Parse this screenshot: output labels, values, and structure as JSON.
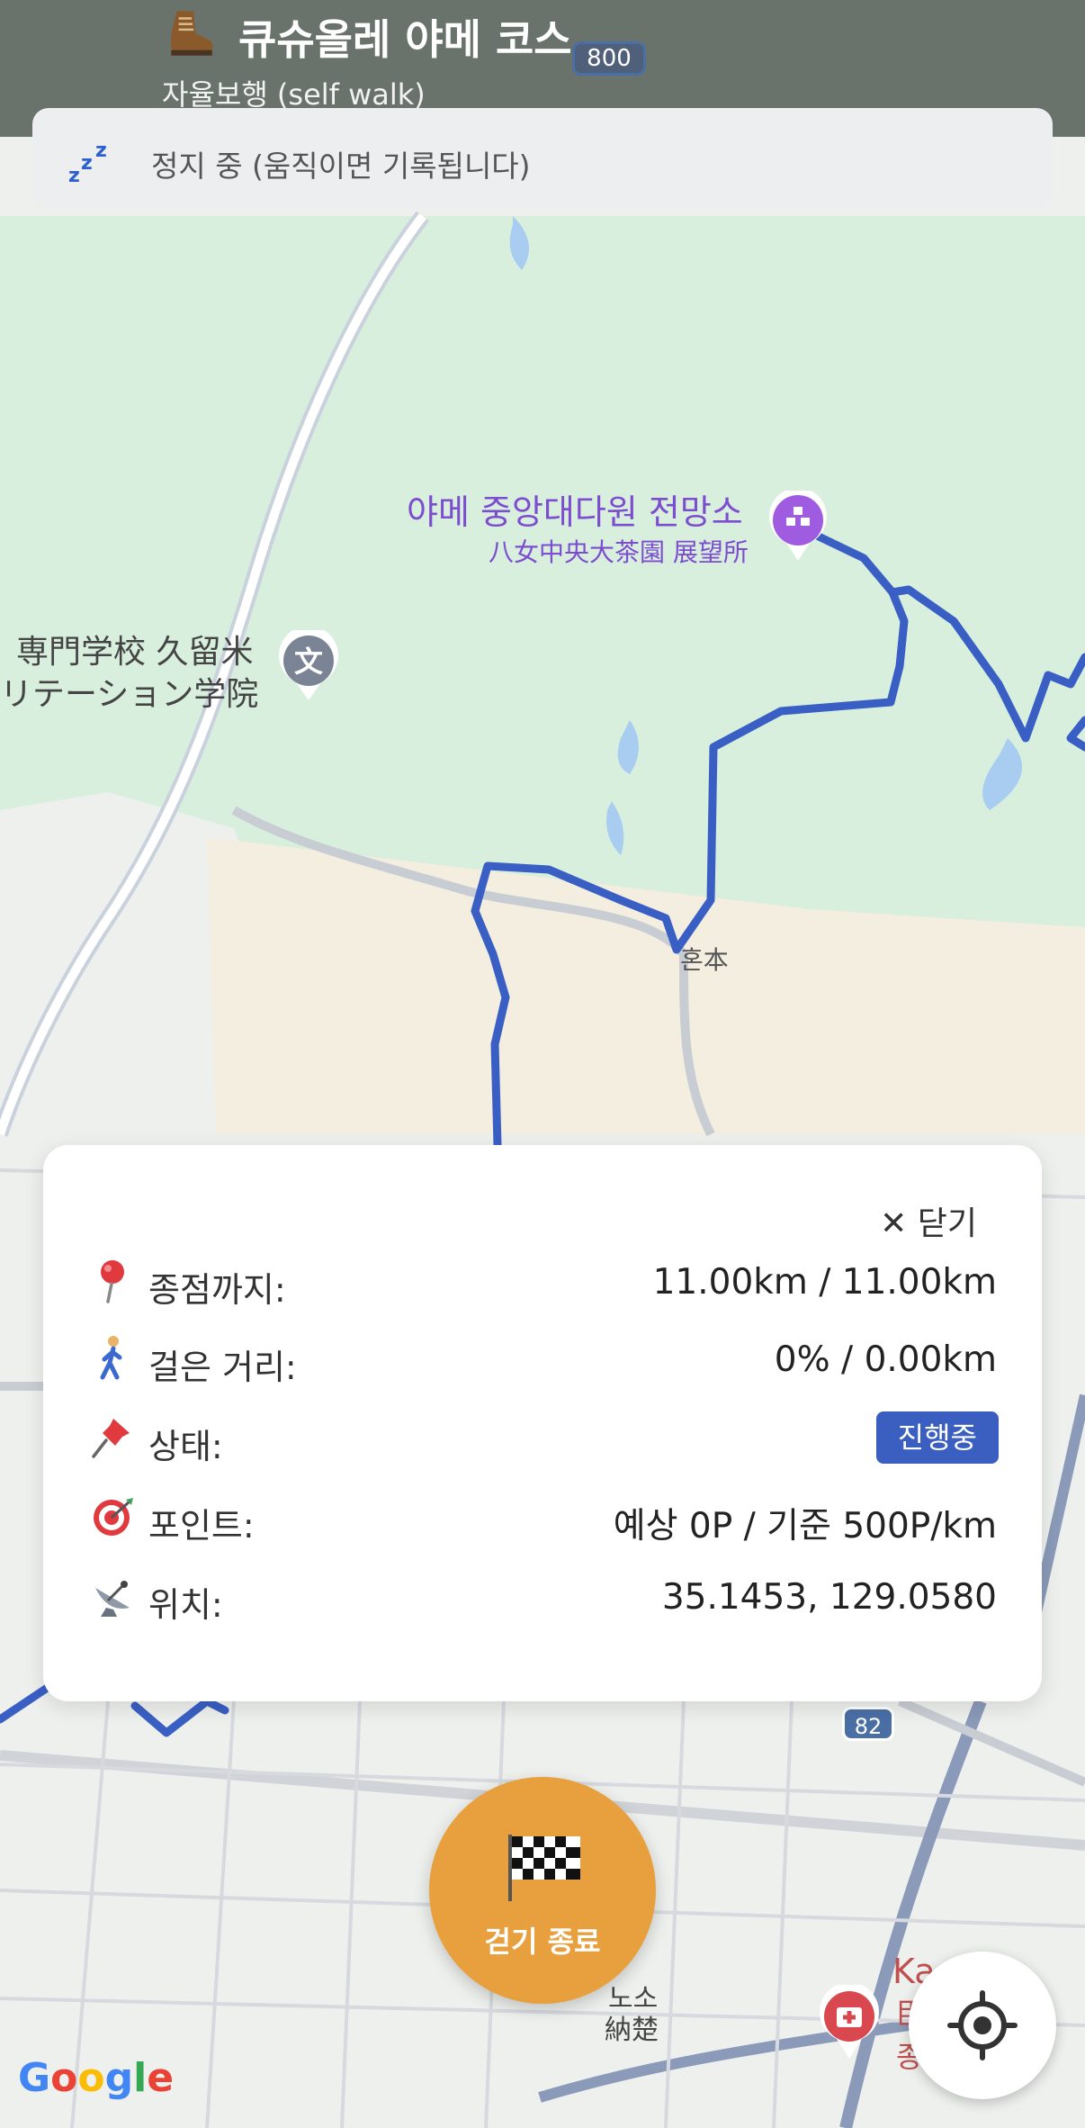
{
  "header": {
    "title": "큐슈올레 야메 코스",
    "subtitle": "자율보행 (self walk)",
    "route_number": "800",
    "icon": "hiking-boot-icon"
  },
  "status": {
    "icon": "sleeping-zzz-icon",
    "text": "정지 중 (움직이면 기록됩니다)"
  },
  "map": {
    "poi_name_ko": "야메 중앙대다원 전망소",
    "poi_name_jp": "八女中央大茶園 展望所",
    "school_line1": "専門学校 久留米",
    "school_line2": "リテーション学院",
    "place_honmoto": "혼本",
    "place_noso_ko": "노소",
    "place_noso_jp": "納楚",
    "hospital_line1": "Ka",
    "hospital_line2": "臣",
    "hospital_line3": "종",
    "road_82": "82",
    "google_logo": "Google",
    "route_color": "#3a5fc4"
  },
  "panel": {
    "close_label": "✕ 닫기",
    "rows": [
      {
        "icon": "pin-icon",
        "label": "종점까지:",
        "value": "11.00km / 11.00km"
      },
      {
        "icon": "walking-person-icon",
        "label": "걸은 거리:",
        "value": "0% / 0.00km"
      },
      {
        "icon": "pushpin-icon",
        "label": "상태:",
        "value": "진행중"
      },
      {
        "icon": "target-icon",
        "label": "포인트:",
        "value": "예상 0P / 기준 500P/km"
      },
      {
        "icon": "satellite-dish-icon",
        "label": "위치:",
        "value": "35.1453, 129.0580"
      }
    ]
  },
  "end_button": {
    "label": "걷기 종료",
    "icon": "checkered-flag-icon",
    "color": "#e8a03e"
  },
  "locate_button": {
    "icon": "locate-crosshair-icon"
  }
}
